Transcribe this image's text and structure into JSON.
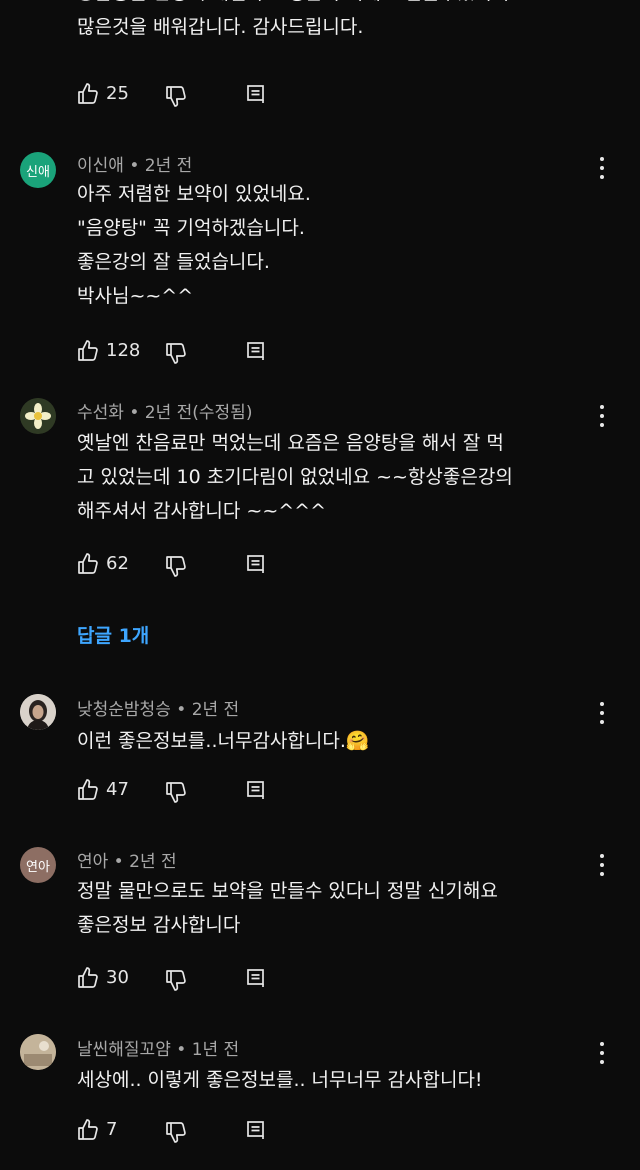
{
  "comments": [
    {
      "text": "궁금중을 한방에 해결하고 생활의 지혜도 얻을수있어서\n많은것을 배워갑니다. 감사드립니다.",
      "likes": "25"
    },
    {
      "avatar_text": "신애",
      "avatar_color": "#1aa37a",
      "author": "이신애",
      "time": "2년 전",
      "text": "아주 저렴한 보약이 있었네요.\n\"음양탕\" 꼭 기억하겠습니다.\n좋은강의 잘 들었습니다.\n박사님~~^^",
      "likes": "128"
    },
    {
      "avatar_icon": "daffodil-icon",
      "author": "수선화",
      "time": "2년 전(수정됨)",
      "text": "옛날엔 찬음료만 먹었는데 요즘은 음양탕을 해서  잘 먹\n고 있었는데 10 초기다림이 없었네요 ~~항상좋은강의\n해주셔서 감사합니다 ~~^^^",
      "likes": "62"
    },
    {
      "avatar_icon": "profile-photo-icon",
      "author": "낮청순밤청승",
      "time": "2년 전",
      "text": "이런 좋은정보를..너무감사합니다.",
      "emoji": "🤗",
      "likes": "47"
    },
    {
      "avatar_text": "연아",
      "avatar_color": "#8d6e63",
      "author": "연아",
      "time": "2년 전",
      "text": "정말 물만으로도 보약을 만들수 있다니 정말 신기해요\n좋은정보 감사합니다",
      "likes": "30"
    },
    {
      "avatar_icon": "profile-photo-icon",
      "author": "날씬해질꼬얌",
      "time": "1년 전",
      "text": "세상에.. 이렇게 좋은정보를.. 너무너무 감사합니다!",
      "likes": "7"
    }
  ],
  "replies_link": "답글 1개",
  "colors": {
    "background": "#0c0c0c",
    "link": "#3ea6ff",
    "meta": "#a8a8a8"
  }
}
